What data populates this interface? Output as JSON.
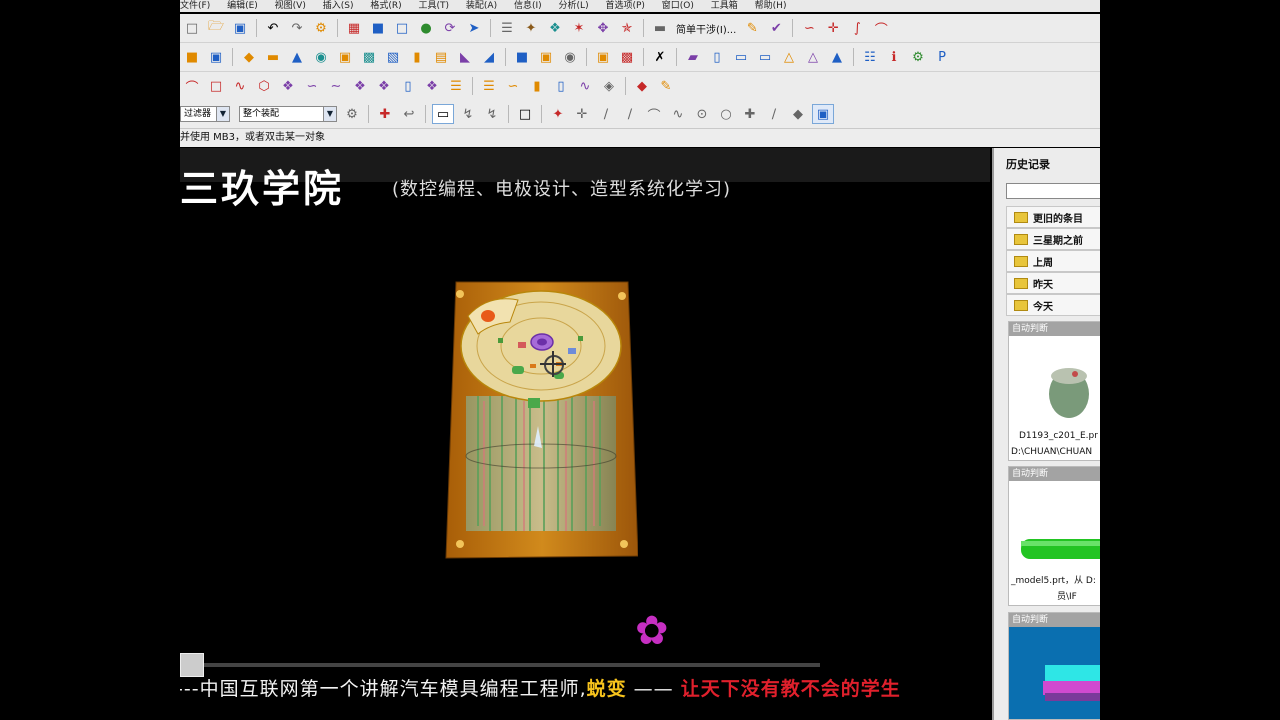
{
  "menu": {
    "items": [
      "文件(F)",
      "编辑(E)",
      "视图(V)",
      "插入(S)",
      "格式(R)",
      "工具(T)",
      "装配(A)",
      "信息(I)",
      "分析(L)",
      "首选项(P)",
      "窗口(O)",
      "工具箱",
      "帮助(H)"
    ]
  },
  "toolbar": {
    "simple_interference_label": "简单干涉(I)..."
  },
  "selection": {
    "filter_value": "过滤器",
    "scope_value": "整个装配"
  },
  "status": {
    "prompt": "并使用 MB3，或者双击某一对象"
  },
  "banner": {
    "brand": "三玖学院",
    "subtitle": "(数控编程、电极设计、造型系统化学习)"
  },
  "caption": {
    "prefix": "---中国互联网第一个讲解汽车模具编程工程师,",
    "highlight": "蜕变",
    "dash": "——",
    "slogan": "让天下没有教不会的学生"
  },
  "history": {
    "title": "历史记录",
    "groups": [
      "更旧的条目",
      "三星期之前",
      "上周",
      "昨天",
      "今天"
    ],
    "cards": [
      {
        "tag": "自动判断",
        "line1": "D1193_c201_E.pr",
        "line2": "D:\\CHUAN\\CHUAN"
      },
      {
        "tag": "自动判断",
        "line1": "_model5.prt，从 D:",
        "line2": "员\\IF"
      },
      {
        "tag": "自动判断",
        "line1": "",
        "line2": ""
      }
    ]
  },
  "colors": {
    "mold_base": "#c87a12",
    "caption_highlight": "#f7c31c",
    "caption_slogan": "#e0202c"
  }
}
